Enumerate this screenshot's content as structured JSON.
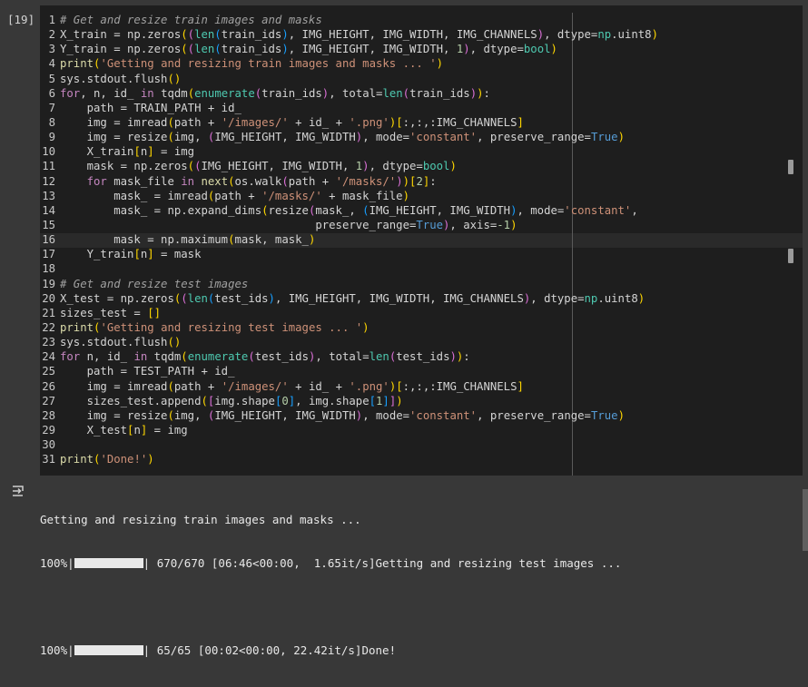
{
  "cell": {
    "execution_count": "[19]",
    "code_lines": [
      [
        [
          "cmt",
          "# Get and resize train images and masks"
        ]
      ],
      [
        [
          "",
          "X_train = np.zeros"
        ],
        [
          "br1",
          "("
        ],
        [
          "br2",
          "("
        ],
        [
          "bi",
          "len"
        ],
        [
          "br3",
          "("
        ],
        [
          "",
          "train_ids"
        ],
        [
          "br3",
          ")"
        ],
        [
          "",
          ", IMG_HEIGHT, IMG_WIDTH, IMG_CHANNELS"
        ],
        [
          "br2",
          ")"
        ],
        [
          "",
          ", dtype="
        ],
        [
          "bi",
          "np"
        ],
        [
          "",
          ".uint8"
        ],
        [
          "br1",
          ")"
        ]
      ],
      [
        [
          "",
          "Y_train = np.zeros"
        ],
        [
          "br1",
          "("
        ],
        [
          "br2",
          "("
        ],
        [
          "bi",
          "len"
        ],
        [
          "br3",
          "("
        ],
        [
          "",
          "train_ids"
        ],
        [
          "br3",
          ")"
        ],
        [
          "",
          ", IMG_HEIGHT, IMG_WIDTH, "
        ],
        [
          "num",
          "1"
        ],
        [
          "br2",
          ")"
        ],
        [
          "",
          ", dtype="
        ],
        [
          "bi",
          "bool"
        ],
        [
          "br1",
          ")"
        ]
      ],
      [
        [
          "fn",
          "print"
        ],
        [
          "br1",
          "("
        ],
        [
          "str",
          "'Getting and resizing train images and masks ... '"
        ],
        [
          "br1",
          ")"
        ]
      ],
      [
        [
          "",
          "sys.stdout.flush"
        ],
        [
          "br1",
          "()"
        ]
      ],
      [
        [
          "kw",
          "for"
        ],
        [
          "",
          ", n, id_ "
        ],
        [
          "kw",
          "in"
        ],
        [
          "",
          " tqdm"
        ],
        [
          "br1",
          "("
        ],
        [
          "bi",
          "enumerate"
        ],
        [
          "br2",
          "("
        ],
        [
          "",
          "train_ids"
        ],
        [
          "br2",
          ")"
        ],
        [
          "",
          ", total="
        ],
        [
          "bi",
          "len"
        ],
        [
          "br2",
          "("
        ],
        [
          "",
          "train_ids"
        ],
        [
          "br2",
          ")"
        ],
        [
          "br1",
          ")"
        ],
        [
          "",
          ":"
        ]
      ],
      [
        [
          "",
          "    path = TRAIN_PATH + id_"
        ]
      ],
      [
        [
          "",
          "    img = imread"
        ],
        [
          "br1",
          "("
        ],
        [
          "",
          "path + "
        ],
        [
          "str",
          "'/images/'"
        ],
        [
          "",
          " + id_ + "
        ],
        [
          "str",
          "'.png'"
        ],
        [
          "br1",
          ")"
        ],
        [
          "br1",
          "["
        ],
        [
          "",
          ":,:,:IMG_CHANNELS"
        ],
        [
          "br1",
          "]"
        ]
      ],
      [
        [
          "",
          "    img = resize"
        ],
        [
          "br1",
          "("
        ],
        [
          "",
          "img, "
        ],
        [
          "br2",
          "("
        ],
        [
          "",
          "IMG_HEIGHT, IMG_WIDTH"
        ],
        [
          "br2",
          ")"
        ],
        [
          "",
          ", mode="
        ],
        [
          "str",
          "'constant'"
        ],
        [
          "",
          ", preserve_range="
        ],
        [
          "cnst",
          "True"
        ],
        [
          "br1",
          ")"
        ]
      ],
      [
        [
          "",
          "    X_train"
        ],
        [
          "br1",
          "["
        ],
        [
          "",
          "n"
        ],
        [
          "br1",
          "]"
        ],
        [
          "",
          " = img"
        ]
      ],
      [
        [
          "",
          "    mask = np.zeros"
        ],
        [
          "br1",
          "("
        ],
        [
          "br2",
          "("
        ],
        [
          "",
          "IMG_HEIGHT, IMG_WIDTH, "
        ],
        [
          "num",
          "1"
        ],
        [
          "br2",
          ")"
        ],
        [
          "",
          ", dtype="
        ],
        [
          "bi",
          "bool"
        ],
        [
          "br1",
          ")"
        ]
      ],
      [
        [
          "kw",
          "    for"
        ],
        [
          "",
          " mask_file "
        ],
        [
          "kw",
          "in"
        ],
        [
          "",
          ""
        ],
        [
          "fn",
          " next"
        ],
        [
          "br1",
          "("
        ],
        [
          "",
          "os.walk"
        ],
        [
          "br2",
          "("
        ],
        [
          "",
          "path + "
        ],
        [
          "str",
          "'/masks/'"
        ],
        [
          "br2",
          ")"
        ],
        [
          "br1",
          ")"
        ],
        [
          "br1",
          "["
        ],
        [
          "num",
          "2"
        ],
        [
          "br1",
          "]"
        ],
        [
          "",
          ":"
        ]
      ],
      [
        [
          "",
          "        mask_ = imread"
        ],
        [
          "br1",
          "("
        ],
        [
          "",
          "path + "
        ],
        [
          "str",
          "'/masks/'"
        ],
        [
          "",
          " + mask_file"
        ],
        [
          "br1",
          ")"
        ]
      ],
      [
        [
          "",
          "        mask_ = np.expand_dims"
        ],
        [
          "br1",
          "("
        ],
        [
          "",
          "resize"
        ],
        [
          "br2",
          "("
        ],
        [
          "",
          "mask_, "
        ],
        [
          "br3",
          "("
        ],
        [
          "",
          "IMG_HEIGHT, IMG_WIDTH"
        ],
        [
          "br3",
          ")"
        ],
        [
          "",
          ", mode="
        ],
        [
          "str",
          "'constant'"
        ],
        [
          "",
          ","
        ]
      ],
      [
        [
          "",
          "                                      preserve_range="
        ],
        [
          "cnst",
          "True"
        ],
        [
          "br2",
          ")"
        ],
        [
          "",
          ", axis="
        ],
        [
          "num",
          "-1"
        ],
        [
          "br1",
          ")"
        ]
      ],
      [
        [
          "",
          "        mask = np.maximum"
        ],
        [
          "br1",
          "("
        ],
        [
          "",
          "mask, mask_"
        ],
        [
          "br1",
          ")"
        ]
      ],
      [
        [
          "",
          "    Y_train"
        ],
        [
          "br1",
          "["
        ],
        [
          "",
          "n"
        ],
        [
          "br1",
          "]"
        ],
        [
          "",
          " = mask"
        ]
      ],
      [
        [
          "",
          ""
        ]
      ],
      [
        [
          "cmt",
          "# Get and resize test images"
        ]
      ],
      [
        [
          "",
          "X_test = np.zeros"
        ],
        [
          "br1",
          "("
        ],
        [
          "br2",
          "("
        ],
        [
          "bi",
          "len"
        ],
        [
          "br3",
          "("
        ],
        [
          "",
          "test_ids"
        ],
        [
          "br3",
          ")"
        ],
        [
          "",
          ", IMG_HEIGHT, IMG_WIDTH, IMG_CHANNELS"
        ],
        [
          "br2",
          ")"
        ],
        [
          "",
          ", dtype="
        ],
        [
          "bi",
          "np"
        ],
        [
          "",
          ".uint8"
        ],
        [
          "br1",
          ")"
        ]
      ],
      [
        [
          "",
          "sizes_test = "
        ],
        [
          "br1",
          "[]"
        ]
      ],
      [
        [
          "fn",
          "print"
        ],
        [
          "br1",
          "("
        ],
        [
          "str",
          "'Getting and resizing test images ... '"
        ],
        [
          "br1",
          ")"
        ]
      ],
      [
        [
          "",
          "sys.stdout.flush"
        ],
        [
          "br1",
          "()"
        ]
      ],
      [
        [
          "kw",
          "for"
        ],
        [
          "",
          " n, id_ "
        ],
        [
          "kw",
          "in"
        ],
        [
          "",
          " tqdm"
        ],
        [
          "br1",
          "("
        ],
        [
          "bi",
          "enumerate"
        ],
        [
          "br2",
          "("
        ],
        [
          "",
          "test_ids"
        ],
        [
          "br2",
          ")"
        ],
        [
          "",
          ", total="
        ],
        [
          "bi",
          "len"
        ],
        [
          "br2",
          "("
        ],
        [
          "",
          "test_ids"
        ],
        [
          "br2",
          ")"
        ],
        [
          "br1",
          ")"
        ],
        [
          "",
          ":"
        ]
      ],
      [
        [
          "",
          "    path = TEST_PATH + id_"
        ]
      ],
      [
        [
          "",
          "    img = imread"
        ],
        [
          "br1",
          "("
        ],
        [
          "",
          "path + "
        ],
        [
          "str",
          "'/images/'"
        ],
        [
          "",
          " + id_ + "
        ],
        [
          "str",
          "'.png'"
        ],
        [
          "br1",
          ")"
        ],
        [
          "br1",
          "["
        ],
        [
          "",
          ":,:,:IMG_CHANNELS"
        ],
        [
          "br1",
          "]"
        ]
      ],
      [
        [
          "",
          "    sizes_test.append"
        ],
        [
          "br1",
          "("
        ],
        [
          "br2",
          "["
        ],
        [
          "",
          "img.shape"
        ],
        [
          "br3",
          "["
        ],
        [
          "num",
          "0"
        ],
        [
          "br3",
          "]"
        ],
        [
          "",
          ", img.shape"
        ],
        [
          "br3",
          "["
        ],
        [
          "num",
          "1"
        ],
        [
          "br3",
          "]"
        ],
        [
          "br2",
          "]"
        ],
        [
          "br1",
          ")"
        ]
      ],
      [
        [
          "",
          "    img = resize"
        ],
        [
          "br1",
          "("
        ],
        [
          "",
          "img, "
        ],
        [
          "br2",
          "("
        ],
        [
          "",
          "IMG_HEIGHT, IMG_WIDTH"
        ],
        [
          "br2",
          ")"
        ],
        [
          "",
          ", mode="
        ],
        [
          "str",
          "'constant'"
        ],
        [
          "",
          ", preserve_range="
        ],
        [
          "cnst",
          "True"
        ],
        [
          "br1",
          ")"
        ]
      ],
      [
        [
          "",
          "    X_test"
        ],
        [
          "br1",
          "["
        ],
        [
          "",
          "n"
        ],
        [
          "br1",
          "]"
        ],
        [
          "",
          " = img"
        ]
      ],
      [
        [
          "",
          ""
        ]
      ],
      [
        [
          "fn",
          "print"
        ],
        [
          "br1",
          "("
        ],
        [
          "str",
          "'Done!'"
        ],
        [
          "br1",
          ")"
        ]
      ]
    ]
  },
  "output": {
    "line1": "Getting and resizing train images and masks ...",
    "progress1_prefix": "100%|",
    "progress1_suffix": "| 670/670 [06:46<00:00,  1.65it/s]Getting and resizing test images ...",
    "progress1_value": 1.0,
    "progress2_prefix": "100%|",
    "progress2_suffix": "| 65/65 [00:02<00:00, 22.42it/s]Done!",
    "progress2_value": 1.0
  },
  "icons": {
    "output_toggle": "output-collapse-icon"
  }
}
